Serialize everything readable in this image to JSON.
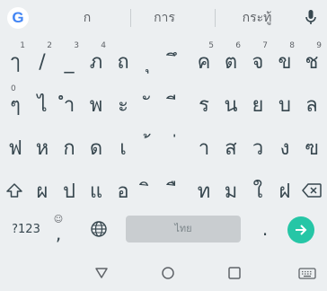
{
  "suggestions": [
    "ก",
    "การ",
    "กระทู้"
  ],
  "rows": [
    {
      "keys": [
        {
          "label": "ๅ",
          "hint": "1"
        },
        {
          "label": "/",
          "hint": "2"
        },
        {
          "label": "_",
          "hint": "3"
        },
        {
          "label": "ภ",
          "hint": "4"
        },
        {
          "label": "ถ",
          "hint": ""
        },
        {
          "label": "ุ",
          "hint": ""
        },
        {
          "label": "ึ",
          "hint": ""
        },
        {
          "label": "ค",
          "hint": "5"
        },
        {
          "label": "ต",
          "hint": "6"
        },
        {
          "label": "จ",
          "hint": "7"
        },
        {
          "label": "ข",
          "hint": "8"
        },
        {
          "label": "ช",
          "hint": "9"
        }
      ]
    },
    {
      "keys": [
        {
          "label": "ๆ",
          "hint": "0"
        },
        {
          "label": "ไ",
          "hint": ""
        },
        {
          "label": "ำ",
          "hint": ""
        },
        {
          "label": "พ",
          "hint": ""
        },
        {
          "label": "ะ",
          "hint": ""
        },
        {
          "label": "ั",
          "hint": ""
        },
        {
          "label": "ี",
          "hint": ""
        },
        {
          "label": "ร",
          "hint": ""
        },
        {
          "label": "น",
          "hint": ""
        },
        {
          "label": "ย",
          "hint": ""
        },
        {
          "label": "บ",
          "hint": ""
        },
        {
          "label": "ล",
          "hint": ""
        }
      ]
    },
    {
      "keys": [
        {
          "label": "ฟ"
        },
        {
          "label": "ห"
        },
        {
          "label": "ก"
        },
        {
          "label": "ด"
        },
        {
          "label": "เ"
        },
        {
          "label": "้"
        },
        {
          "label": "่"
        },
        {
          "label": "า"
        },
        {
          "label": "ส"
        },
        {
          "label": "ว"
        },
        {
          "label": "ง"
        },
        {
          "label": "ฃ"
        }
      ]
    },
    {
      "keys": [
        {
          "label": "ผ"
        },
        {
          "label": "ป"
        },
        {
          "label": "แ"
        },
        {
          "label": "อ"
        },
        {
          "label": "ิ"
        },
        {
          "label": "ื"
        },
        {
          "label": "ท"
        },
        {
          "label": "ม"
        },
        {
          "label": "ใ"
        },
        {
          "label": "ฝ"
        }
      ]
    }
  ],
  "bottom": {
    "symbols_label": "?123",
    "comma_label": ",",
    "comma_hint": "☺",
    "space_label": "ไทย",
    "period_label": "."
  },
  "icons": {
    "shift": "shift-icon",
    "delete": "backspace-icon",
    "globe": "globe-icon",
    "enter": "arrow-right-icon",
    "mic": "mic-icon"
  },
  "colors": {
    "background": "#eceff1",
    "key_text": "#37474f",
    "enter": "#26c6a6",
    "spacebar": "#c9cdd0",
    "google_blue": "#4285f4"
  }
}
